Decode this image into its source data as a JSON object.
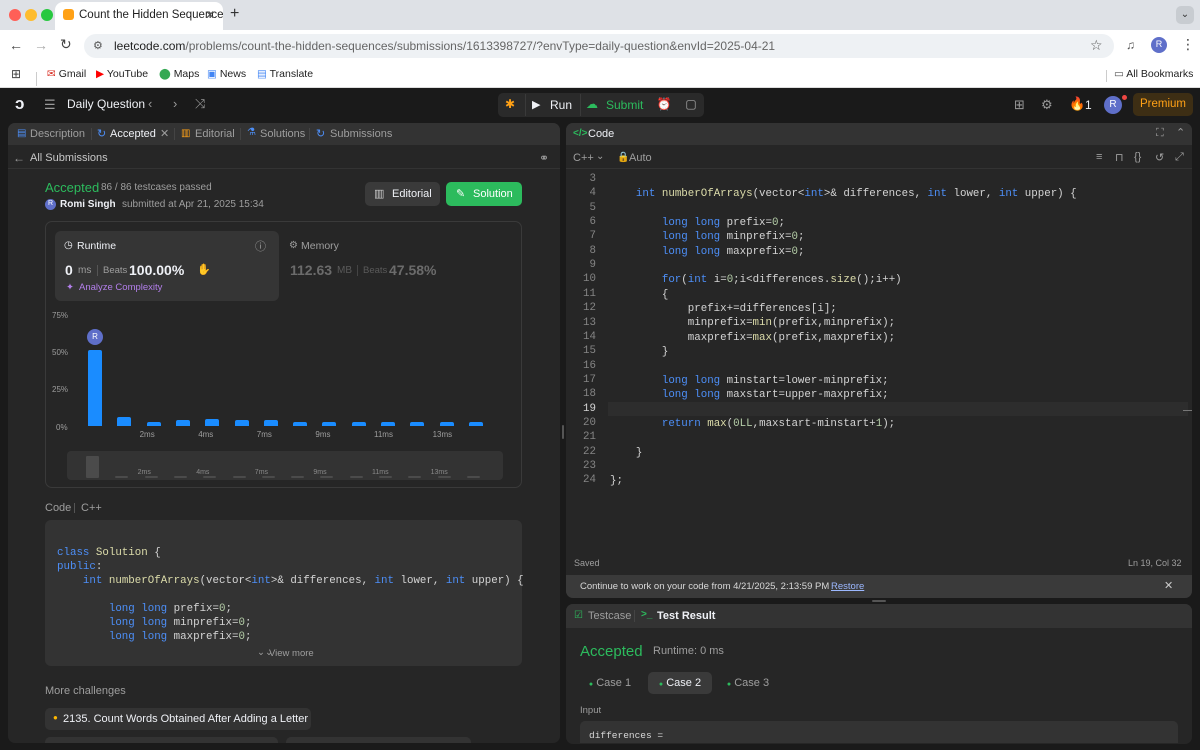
{
  "browser": {
    "tab_title": "Count the Hidden Sequences",
    "url_host": "leetcode.com",
    "url_path": "/problems/count-the-hidden-sequences/submissions/1613398727/?envType=daily-question&envId=2025-04-21",
    "avatar_letter": "R",
    "bookmarks": [
      "Gmail",
      "YouTube",
      "Maps",
      "News",
      "Translate"
    ],
    "all_bookmarks": "All Bookmarks"
  },
  "nav": {
    "title": "Daily Question",
    "run": "Run",
    "submit": "Submit",
    "streak": "1",
    "avatar_letter": "R",
    "premium": "Premium"
  },
  "left": {
    "tabs": {
      "description": "Description",
      "accepted": "Accepted",
      "editorial": "Editorial",
      "solutions": "Solutions",
      "submissions": "Submissions"
    },
    "all_submissions": "All Submissions",
    "status": "Accepted",
    "testcases": "86 / 86 testcases passed",
    "user": "Romi Singh",
    "submitted": "submitted at Apr 21, 2025 15:34",
    "editorial_btn": "Editorial",
    "solution_btn": "Solution",
    "runtime_label": "Runtime",
    "runtime_value": "0",
    "runtime_unit": "ms",
    "beats_label": "Beats",
    "runtime_beats": "100.00%",
    "analyze": "Analyze Complexity",
    "memory_label": "Memory",
    "memory_value": "112.63",
    "memory_unit": "MB",
    "memory_beats": "47.58%",
    "code_label": "Code",
    "code_lang": "C++",
    "view_more": "View more",
    "more_challenges": "More challenges",
    "challenge_1": "2135. Count Words Obtained After Adding a Letter",
    "code_lines": [
      "class Solution {",
      "public:",
      "    int numberOfArrays(vector<int>& differences, int lower, int upper) {",
      "",
      "        long long prefix=0;",
      "        long long minprefix=0;",
      "        long long maxprefix=0;"
    ]
  },
  "chart_data": {
    "type": "bar",
    "ylabel_ticks": [
      "75%",
      "50%",
      "25%",
      "0%"
    ],
    "x_tick_labels": [
      "2ms",
      "4ms",
      "7ms",
      "9ms",
      "11ms",
      "13ms"
    ],
    "values": [
      51,
      6,
      3,
      4,
      5,
      4,
      4,
      3,
      3,
      3,
      3,
      3,
      3,
      3
    ],
    "ylim": [
      0,
      75
    ],
    "marker_letter": "R",
    "mini_values": [
      28,
      3,
      3,
      3,
      3,
      3,
      3,
      3,
      3,
      3,
      3,
      3,
      3,
      3
    ]
  },
  "editor": {
    "title": "Code",
    "language": "C++",
    "mode": "Auto",
    "saved": "Saved",
    "cursor": "Ln 19, Col 32",
    "line_numbers": [
      "3",
      "4",
      "5",
      "6",
      "7",
      "8",
      "9",
      "10",
      "11",
      "12",
      "13",
      "14",
      "15",
      "16",
      "17",
      "18",
      "19",
      "20",
      "21",
      "22",
      "23",
      "24"
    ],
    "notice": "Continue to work on your code from 4/21/2025, 2:13:59 PM",
    "restore": "Restore"
  },
  "result": {
    "testcase_tab": "Testcase",
    "result_tab": "Test Result",
    "status": "Accepted",
    "runtime": "Runtime: 0 ms",
    "cases": [
      "Case 1",
      "Case 2",
      "Case 3"
    ],
    "input_label": "Input",
    "input_var": "differences ="
  },
  "colors": {
    "accent_green": "#2cbb5d",
    "bar_blue": "#1a8cff",
    "premium": "#ffa116"
  }
}
